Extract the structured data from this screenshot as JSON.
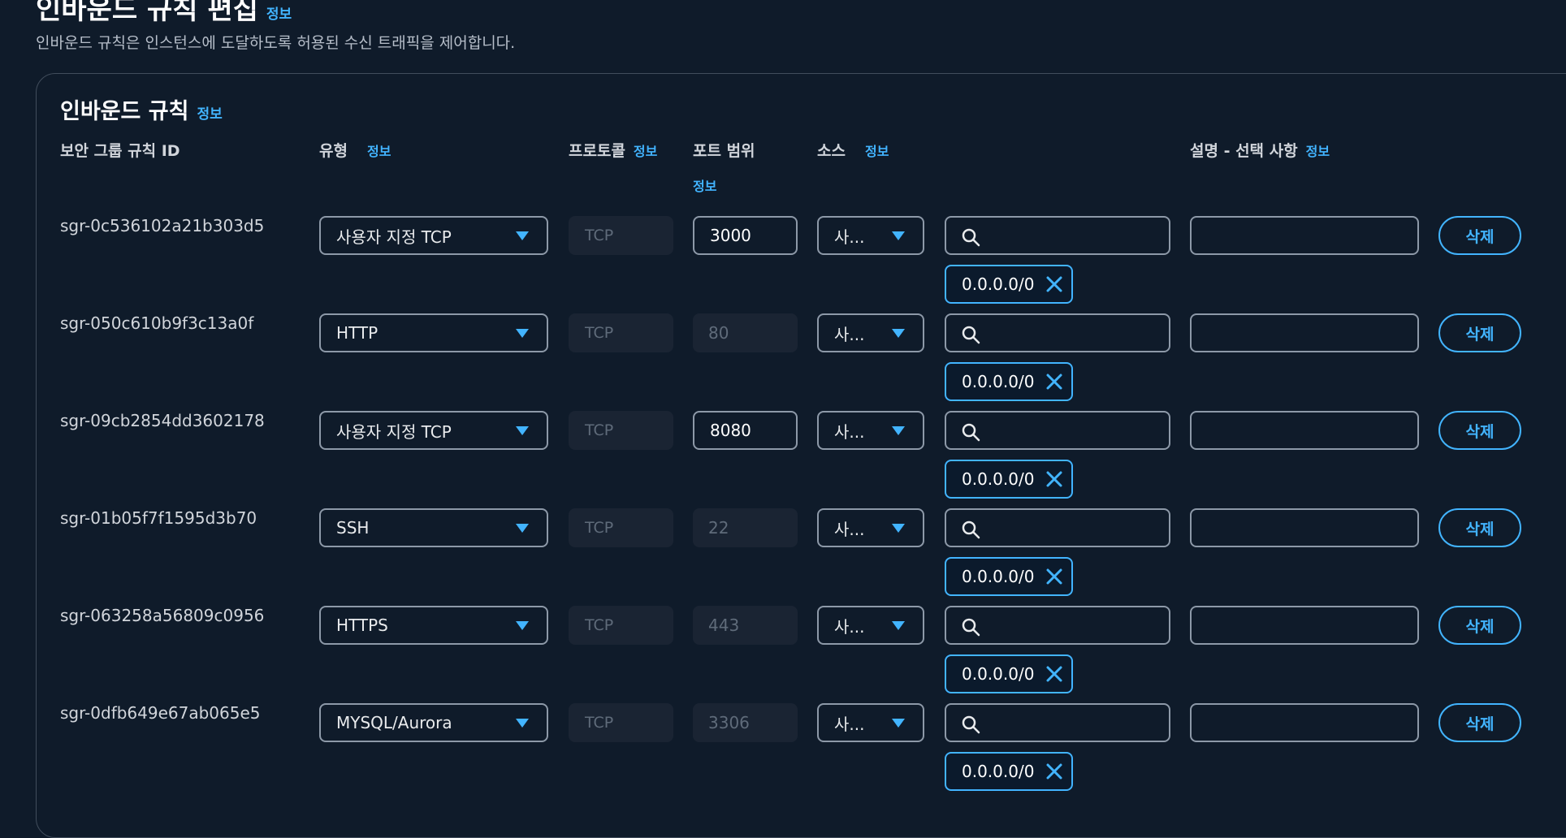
{
  "header": {
    "title": "인바운드 규칙 편집",
    "info": "정보",
    "description": "인바운드 규칙은 인스턴스에 도달하도록 허용된 수신 트래픽을 제어합니다."
  },
  "section": {
    "title": "인바운드 규칙",
    "info": "정보"
  },
  "columns": {
    "rule_id": "보안 그룹 규칙 ID",
    "type": "유형",
    "protocol": "프로토콜",
    "port_range": "포트 범위",
    "source": "소스",
    "description": "설명 - 선택 사항",
    "info": "정보"
  },
  "rules": [
    {
      "id": "sgr-0c536102a21b303d5",
      "type": "사용자 지정 TCP",
      "protocol": "TCP",
      "port": "3000",
      "port_editable": true,
      "source": "사...",
      "cidr": "0.0.0.0/0",
      "description": "",
      "delete": "삭제"
    },
    {
      "id": "sgr-050c610b9f3c13a0f",
      "type": "HTTP",
      "protocol": "TCP",
      "port": "80",
      "port_editable": false,
      "source": "사...",
      "cidr": "0.0.0.0/0",
      "description": "",
      "delete": "삭제"
    },
    {
      "id": "sgr-09cb2854dd3602178",
      "type": "사용자 지정 TCP",
      "protocol": "TCP",
      "port": "8080",
      "port_editable": true,
      "source": "사...",
      "cidr": "0.0.0.0/0",
      "description": "",
      "delete": "삭제"
    },
    {
      "id": "sgr-01b05f7f1595d3b70",
      "type": "SSH",
      "protocol": "TCP",
      "port": "22",
      "port_editable": false,
      "source": "사...",
      "cidr": "0.0.0.0/0",
      "description": "",
      "delete": "삭제"
    },
    {
      "id": "sgr-063258a56809c0956",
      "type": "HTTPS",
      "protocol": "TCP",
      "port": "443",
      "port_editable": false,
      "source": "사...",
      "cidr": "0.0.0.0/0",
      "description": "",
      "delete": "삭제"
    },
    {
      "id": "sgr-0dfb649e67ab065e5",
      "type": "MYSQL/Aurora",
      "protocol": "TCP",
      "port": "3306",
      "port_editable": false,
      "source": "사...",
      "cidr": "0.0.0.0/0",
      "description": "",
      "delete": "삭제"
    }
  ],
  "colors": {
    "background": "#0f1b2a",
    "accent": "#42b4ff",
    "border": "#8d99a8"
  },
  "icons": [
    "search-icon",
    "close-icon",
    "caret-down-icon"
  ]
}
